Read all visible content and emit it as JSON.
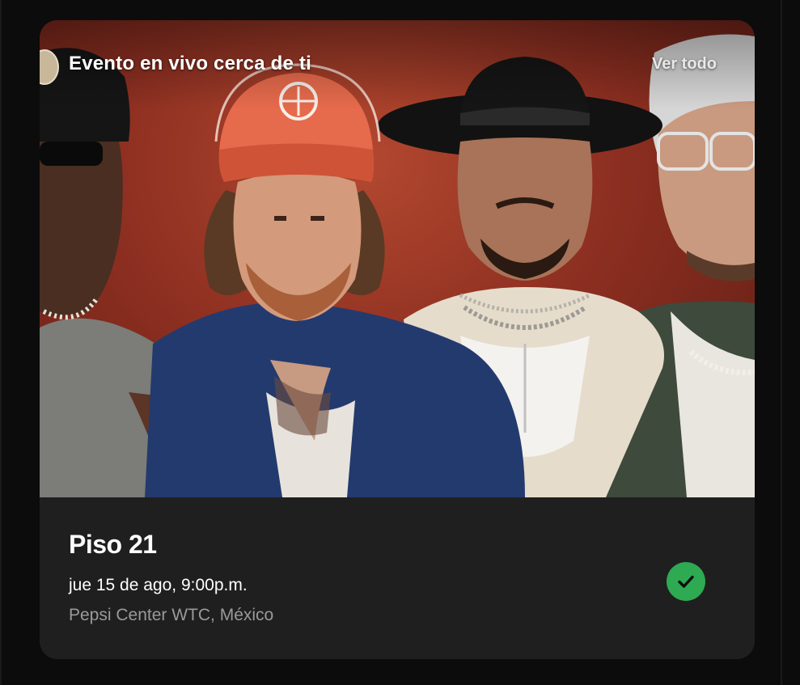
{
  "section": {
    "title": "Evento en vivo cerca de ti",
    "see_all_label": "Ver todo"
  },
  "event": {
    "artist": "Piso 21",
    "datetime": "jue 15 de ago, 9:00p.m.",
    "venue": "Pepsi Center WTC, México",
    "image_icon": "artist-group-photo",
    "status_icon": "check-circle-icon"
  },
  "colors": {
    "background": "#0c0c0c",
    "card": "#1f1f1f",
    "hero_red": "#9b3524",
    "check_green": "#2eaa52",
    "venue_text": "#9a9a9a"
  }
}
